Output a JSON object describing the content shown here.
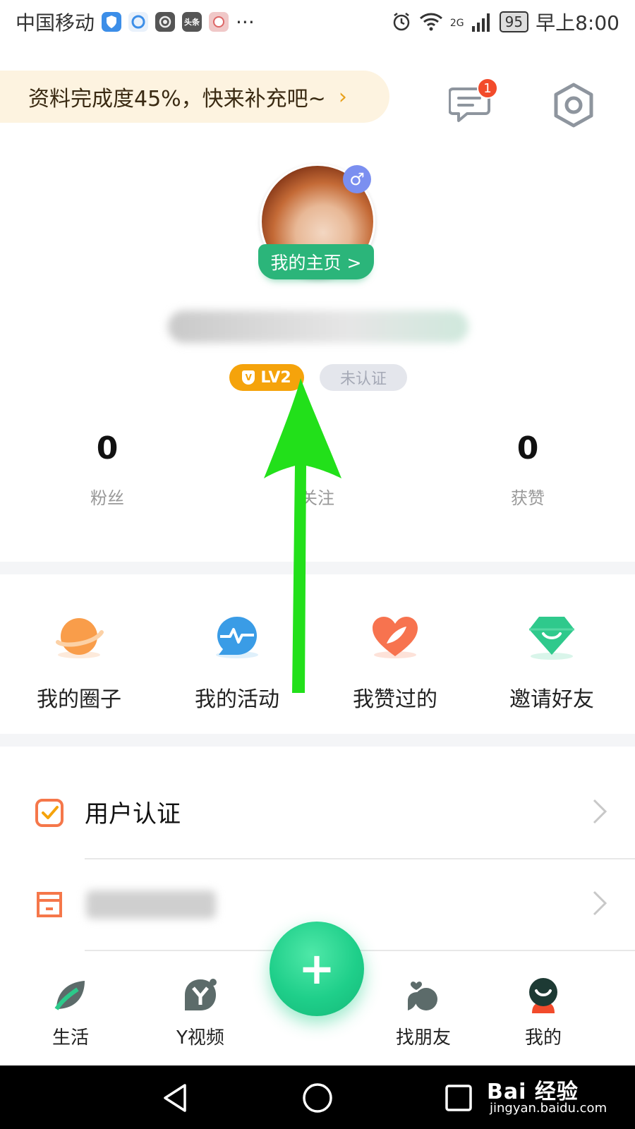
{
  "status_bar": {
    "carrier": "中国移动",
    "notification_icons": [
      "shield-icon",
      "browser-icon",
      "camera-app-icon",
      "toutiao-icon",
      "cartoon-app-icon"
    ],
    "toutiao_text": "头条",
    "more": "···",
    "network": "2G",
    "battery": "95",
    "time": "早上8:00"
  },
  "header": {
    "profile_prompt": "资料完成度45%，快来补充吧~",
    "message_badge_count": "1",
    "accent_color": "#e8a01a"
  },
  "profile": {
    "gender_symbol": "♂",
    "homepage_label": "我的主页 >",
    "level": "LV2",
    "verify_status": "未认证"
  },
  "stats": [
    {
      "value": "0",
      "label": "粉丝"
    },
    {
      "value": "0",
      "label": "关注"
    },
    {
      "value": "0",
      "label": "获赞"
    }
  ],
  "quick_actions": [
    {
      "label": "我的圈子",
      "icon": "planet-icon"
    },
    {
      "label": "我的活动",
      "icon": "activity-pulse-icon"
    },
    {
      "label": "我赞过的",
      "icon": "heart-leaf-icon"
    },
    {
      "label": "邀请好友",
      "icon": "smile-gem-icon"
    }
  ],
  "list": [
    {
      "label": "用户认证",
      "icon": "verify-checkbox-icon"
    },
    {
      "label": "",
      "icon": "archive-icon"
    }
  ],
  "bottom_nav": [
    {
      "label": "生活",
      "icon": "life-leaf-icon"
    },
    {
      "label": "Y视频",
      "icon": "y-video-icon"
    },
    {
      "label": "找朋友",
      "icon": "find-friends-icon"
    },
    {
      "label": "我的",
      "icon": "me-avatar-icon"
    }
  ],
  "fab_symbol": "+",
  "watermark": {
    "brand": "Bai 经验",
    "url": "jingyan.baidu.com"
  },
  "colors": {
    "brand_green": "#2bb57a",
    "fab_green": "#1fcf8a",
    "level_orange": "#f5a30b",
    "badge_red": "#f24b2b",
    "annotation_arrow": "#22e01a"
  }
}
